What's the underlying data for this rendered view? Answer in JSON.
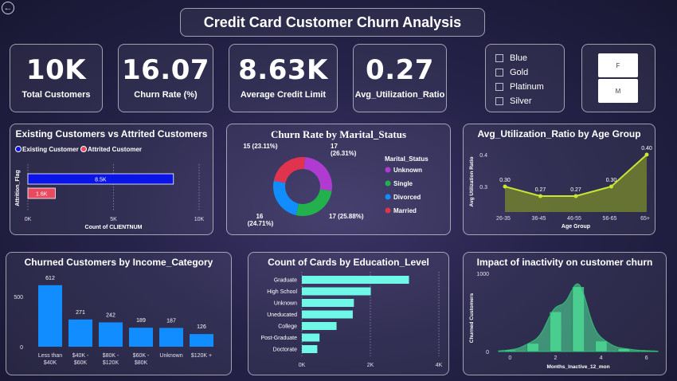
{
  "header": {
    "title": "Credit Card Customer Churn Analysis",
    "back_icon": "back-arrow-icon"
  },
  "kpis": [
    {
      "value": "10K",
      "label": "Total Customers"
    },
    {
      "value": "16.07",
      "label": "Churn Rate (%)"
    },
    {
      "value": "8.63K",
      "label": "Average Credit Limit"
    },
    {
      "value": "0.27",
      "label": "Avg_Utilization_Ratio"
    }
  ],
  "card_slicer": {
    "options": [
      "Blue",
      "Gold",
      "Platinum",
      "Silver"
    ]
  },
  "gender_slicer": {
    "options": [
      "F",
      "M"
    ]
  },
  "colors": {
    "existing": "#0a14e6",
    "attrited": "#e84a5f",
    "bar_blue": "#118dff",
    "cyan": "#6ff7e8",
    "lime": "#c8e632",
    "green": "#4ee89a"
  },
  "chart_data": [
    {
      "type": "bar",
      "title": "Existing Customers vs Attrited Customers",
      "orientation": "horizontal",
      "legend": [
        "Existing Customer",
        "Attrited Customer"
      ],
      "series": [
        {
          "name": "Existing Customer",
          "values": [
            8500
          ],
          "label": "8.5K"
        },
        {
          "name": "Attrited Customer",
          "values": [
            1600
          ],
          "label": "1.6K"
        }
      ],
      "xlabel": "Count of CLIENTNUM",
      "ylabel": "Attrition_Flag",
      "xticks": [
        "0K",
        "5K",
        "10K"
      ],
      "xlim": [
        0,
        10000
      ]
    },
    {
      "type": "pie",
      "title": "Churn Rate by Marital_Status",
      "legend_title": "Marital_Status",
      "slices": [
        {
          "name": "Unknown",
          "value": 17,
          "pct": "(26.31%)",
          "color": "#b03bd0"
        },
        {
          "name": "Single",
          "value": 17,
          "pct": "(25.88%)",
          "color": "#22b14c"
        },
        {
          "name": "Divorced",
          "value": 16,
          "pct": "(24.71%)",
          "color": "#118dff"
        },
        {
          "name": "Married",
          "value": 15,
          "pct": "(23.11%)",
          "color": "#e0334d"
        }
      ]
    },
    {
      "type": "area",
      "title": "Avg_Utilization_Ratio by Age Group",
      "categories": [
        "26-35",
        "36-45",
        "46-55",
        "56-65",
        "65+"
      ],
      "values": [
        0.3,
        0.27,
        0.27,
        0.3,
        0.4
      ],
      "labels": [
        "0.30",
        "0.27",
        "0.27",
        "0.30",
        "0.40"
      ],
      "xlabel": "Age Group",
      "ylabel": "Avg Utilization Ratio",
      "yticks": [
        "0.3",
        "0.4"
      ],
      "ylim": [
        0.22,
        0.42
      ]
    },
    {
      "type": "bar",
      "title": "Churned Customers by Income_Category",
      "categories": [
        "Less than\n$40K",
        "$40K -\n$60K",
        "$80K -\n$120K",
        "$60K -\n$80K",
        "Unknown",
        "$120K +"
      ],
      "values": [
        612,
        271,
        242,
        189,
        187,
        126
      ],
      "yticks": [
        "0",
        "500"
      ],
      "ylim": [
        0,
        650
      ]
    },
    {
      "type": "bar",
      "orientation": "horizontal",
      "title": "Count of Cards by Education_Level",
      "categories": [
        "Graduate",
        "High School",
        "Unknown",
        "Uneducated",
        "College",
        "Post-Graduate",
        "Doctorate"
      ],
      "values": [
        3128,
        2013,
        1519,
        1487,
        1013,
        516,
        451
      ],
      "xticks": [
        "0K",
        "2K",
        "4K"
      ],
      "xlim": [
        0,
        4000
      ]
    },
    {
      "type": "area",
      "title": "Impact of inactivity on customer churn",
      "x": [
        0,
        1,
        2,
        3,
        4,
        5,
        6
      ],
      "values": [
        15,
        100,
        505,
        826,
        130,
        32,
        9
      ],
      "xlabel": "Months_Inactive_12_mon",
      "ylabel": "Churned Customers",
      "xticks": [
        "0",
        "2",
        "4",
        "6"
      ],
      "yticks": [
        "0",
        "1000"
      ],
      "ylim": [
        0,
        1000
      ],
      "xlim": [
        -0.5,
        6.5
      ]
    }
  ]
}
